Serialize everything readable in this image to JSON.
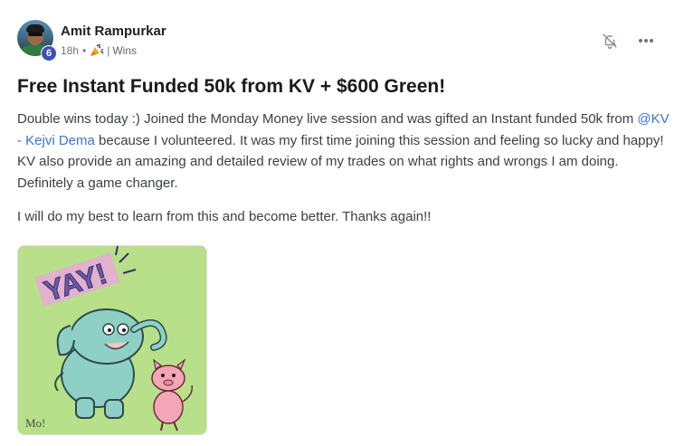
{
  "author": {
    "name": "Amit Rampurkar",
    "level": "6"
  },
  "meta": {
    "time": "18h",
    "separator": "•",
    "category_icon": "party-popper-icon",
    "divider": "|",
    "category": "Wins"
  },
  "actions": {
    "notification_icon": "bell-off-icon",
    "more_icon": "more-horizontal-icon"
  },
  "post": {
    "title": "Free Instant Funded 50k from KV + $600 Green!",
    "paragraph1_before": "Double wins today :) Joined the Monday Money live session and was gifted an Instant funded 50k from ",
    "mention": "@KV - Kejvi Dema",
    "paragraph1_after": " because I volunteered. It was my first time joining this session and feeling so lucky and happy! KV also provide an amazing and detailed review of my trades on what rights and wrongs I am doing. Definitely a game changer.",
    "paragraph2": "I will do my best to learn from this and become better. Thanks again!!"
  },
  "image": {
    "caption_text": "YAY!",
    "signature": "Mo!",
    "background_color": "#b8e08a",
    "elephant_color": "#8fd0c6",
    "pig_color": "#f2a6b8"
  },
  "colors": {
    "mention": "#3b73d9",
    "badge": "#3f51b5"
  }
}
